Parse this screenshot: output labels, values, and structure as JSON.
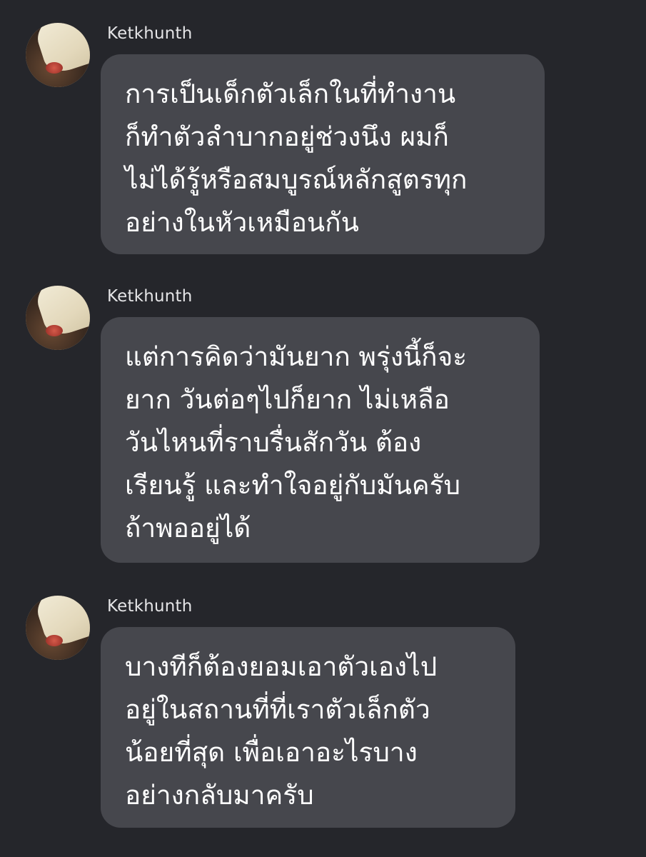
{
  "messages": [
    {
      "sender": "Ketkhunth",
      "lines": [
        "การเป็นเด็กตัวเล็กในที่ทำงาน",
        "ก็ทำตัวลำบากอยู่ช่วงนึง ผมก็",
        "ไม่ได้รู้หรือสมบูรณ์หลักสูตรทุก",
        "อย่างในหัวเหมือนกัน"
      ]
    },
    {
      "sender": "Ketkhunth",
      "lines": [
        "แต่การคิดว่ามันยาก พรุ่งนี้ก็จะ",
        "ยาก วันต่อๆไปก็ยาก ไม่เหลือ",
        "วันไหนที่ราบรื่นสักวัน ต้อง",
        "เรียนรู้ และทำใจอยู่กับมันครับ",
        "ถ้าพออยู่ได้"
      ]
    },
    {
      "sender": "Ketkhunth",
      "lines": [
        "บางทีก็ต้องยอมเอาตัวเองไป",
        "อยู่ในสถานที่ที่เราตัวเล็กตัว",
        "น้อยที่สุด เพื่อเอาอะไรบาง",
        "อย่างกลับมาครับ"
      ]
    }
  ]
}
